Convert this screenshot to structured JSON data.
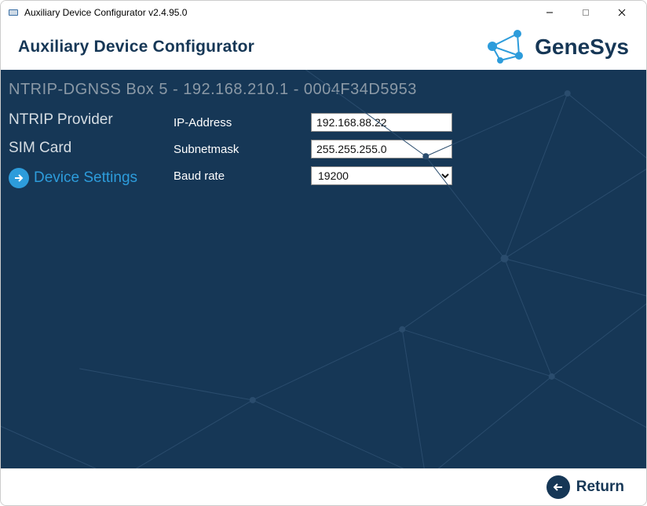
{
  "window": {
    "title": "Auxiliary Device Configurator v2.4.95.0"
  },
  "header": {
    "app_title": "Auxiliary Device Configurator",
    "brand": "GeneSys"
  },
  "breadcrumb": "NTRIP-DGNSS Box 5 - 192.168.210.1 - 0004F34D5953",
  "sidebar": {
    "items": [
      {
        "label": "NTRIP Provider",
        "active": false
      },
      {
        "label": "SIM Card",
        "active": false
      },
      {
        "label": "Device Settings",
        "active": true
      }
    ]
  },
  "form": {
    "ip": {
      "label": "IP-Address",
      "value": "192.168.88.22"
    },
    "subnet": {
      "label": "Subnetmask",
      "value": "255.255.255.0"
    },
    "baud": {
      "label": "Baud rate",
      "value": "19200"
    }
  },
  "footer": {
    "return_label": "Return"
  }
}
